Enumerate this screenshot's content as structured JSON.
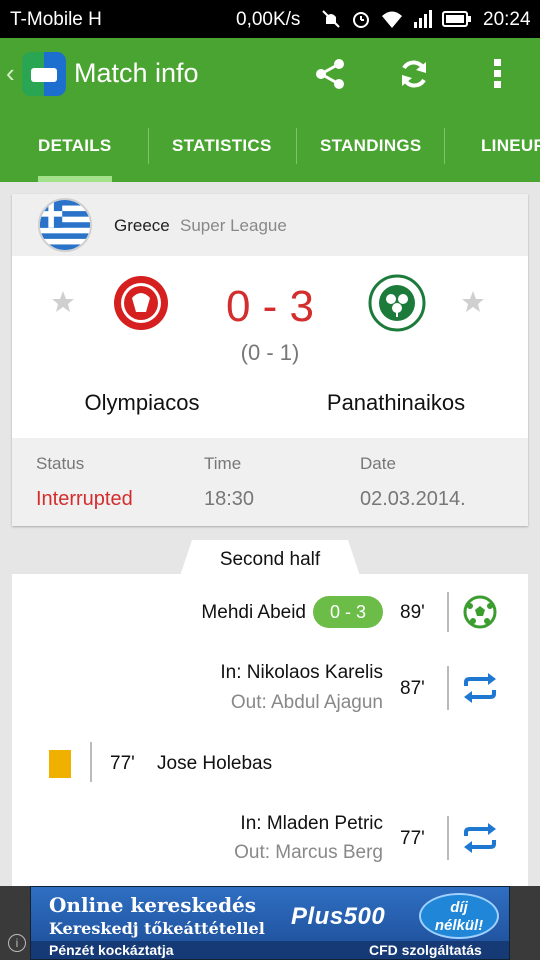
{
  "status_bar": {
    "carrier": "T-Mobile H",
    "speed": "0,00K/s",
    "time": "20:24"
  },
  "app_bar": {
    "title": "Match info"
  },
  "tabs": [
    {
      "label": "DETAILS",
      "active": true
    },
    {
      "label": "STATISTICS",
      "active": false
    },
    {
      "label": "STANDINGS",
      "active": false
    },
    {
      "label": "LINEUPS",
      "active": false
    }
  ],
  "match": {
    "country": "Greece",
    "league": "Super League",
    "score": "0 - 3",
    "halftime": "(0 - 1)",
    "home": "Olympiacos",
    "away": "Panathinaikos",
    "status_label": "Status",
    "status_value": "Interrupted",
    "time_label": "Time",
    "time_value": "18:30",
    "date_label": "Date",
    "date_value": "02.03.2014."
  },
  "events": {
    "period": "Second half",
    "goal": {
      "player": "Mehdi Abeid",
      "score": "0 - 3",
      "minute": "89'"
    },
    "sub1": {
      "in": "In: Nikolaos Karelis",
      "out": "Out: Abdul Ajagun",
      "minute": "87'"
    },
    "card": {
      "minute": "77'",
      "player": "Jose Holebas"
    },
    "sub2": {
      "in": "In: Mladen Petric",
      "out": "Out: Marcus Berg",
      "minute": "77'"
    }
  },
  "ad": {
    "line1": "Online kereskedés",
    "line2": "Kereskedj tőkeáttétellel",
    "line3": "Pénzét kockáztatja",
    "line4": "CFD szolgáltatás",
    "brand": "Plus500",
    "badge1": "díj",
    "badge2": "nélkül!"
  },
  "colors": {
    "green": "#4aa431",
    "accent_red": "#d32d2d",
    "pill_green": "#6cbd47",
    "icon_blue": "#1e78d2"
  }
}
